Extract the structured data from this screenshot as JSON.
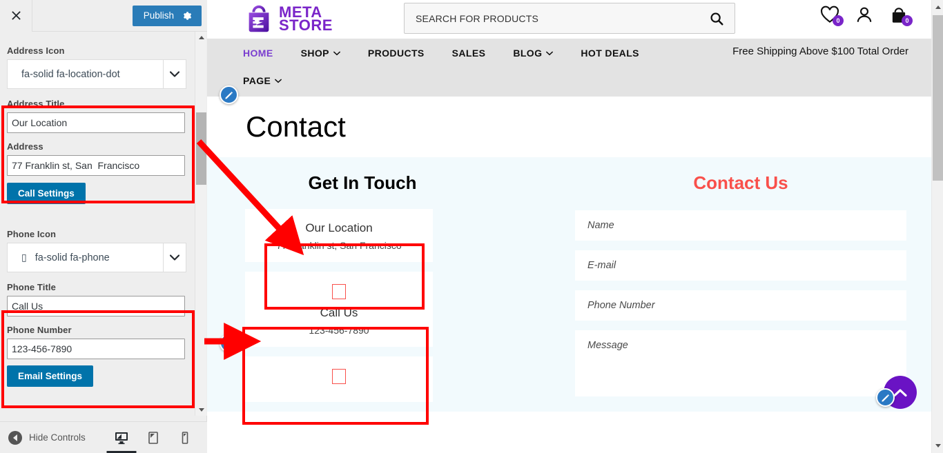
{
  "customizer": {
    "close_label": "×",
    "publish_label": "Publish",
    "gear_icon": "gear-icon",
    "address_icon_label": "Address Icon",
    "address_icon_value": "fa-solid fa-location-dot",
    "address_title_label": "Address Title",
    "address_title_value": "Our Location",
    "address_label": "Address",
    "address_value": "77 Franklin st, San  Francisco",
    "call_settings_label": "Call Settings",
    "phone_icon_label": "Phone Icon",
    "phone_icon_glyph": "▯",
    "phone_icon_value": "fa-solid fa-phone",
    "phone_title_label": "Phone Title",
    "phone_title_value": "Call Us",
    "phone_number_label": "Phone Number",
    "phone_number_value": "123-456-7890",
    "email_settings_label": "Email Settings",
    "hide_controls_label": "Hide Controls",
    "devices": [
      {
        "name": "desktop",
        "active": true
      },
      {
        "name": "tablet",
        "active": false
      },
      {
        "name": "mobile",
        "active": false
      }
    ]
  },
  "site": {
    "logo": {
      "line1": "META",
      "line2": "STORE",
      "icon": "shopping-bag-icon"
    },
    "search": {
      "placeholder": "SEARCH FOR PRODUCTS",
      "value": "",
      "icon": "search-icon"
    },
    "header_icons": [
      {
        "name": "wishlist-icon",
        "count": "0"
      },
      {
        "name": "account-icon",
        "count": ""
      },
      {
        "name": "cart-icon",
        "count": "0"
      }
    ],
    "nav": [
      {
        "label": "HOME",
        "has_caret": false,
        "active": true
      },
      {
        "label": "SHOP",
        "has_caret": true,
        "active": false
      },
      {
        "label": "PRODUCTS",
        "has_caret": false,
        "active": false
      },
      {
        "label": "SALES",
        "has_caret": false,
        "active": false
      },
      {
        "label": "BLOG",
        "has_caret": true,
        "active": false
      },
      {
        "label": "HOT DEALS",
        "has_caret": false,
        "active": false
      }
    ],
    "nav_row2": [
      {
        "label": "PAGE",
        "has_caret": true,
        "active": false
      }
    ],
    "free_shipping": "Free Shipping Above $100 Total Order",
    "page_title": "Contact",
    "get_in_touch_title": "Get In Touch",
    "info_cards": [
      {
        "title": "Our Location",
        "sub": "77 Franklin st, San Francisco",
        "has_icon": false,
        "icon": "location-dot-icon"
      },
      {
        "title": "Call Us",
        "sub": "123-456-7890",
        "has_icon": true,
        "icon": "phone-icon"
      },
      {
        "title": "",
        "sub": "",
        "has_icon": true,
        "icon": "envelope-icon"
      }
    ],
    "contact_form": {
      "title": "Contact Us",
      "title_color": "#f9504b",
      "fields": [
        {
          "name": "name",
          "placeholder": "Name",
          "value": ""
        },
        {
          "name": "email",
          "placeholder": "E-mail",
          "value": ""
        },
        {
          "name": "phone",
          "placeholder": "Phone Number",
          "value": ""
        },
        {
          "name": "message",
          "placeholder": "Message",
          "value": ""
        }
      ]
    },
    "back_to_top_icon": "chevron-up-icon"
  },
  "colors": {
    "accent_purple": "#7a25c9",
    "publish_blue": "#2a7cb8",
    "section_blue": "#0073aa",
    "annotation_red": "#ff0000",
    "contact_title_red": "#f9504b",
    "section_bg": "#f2fafd"
  }
}
